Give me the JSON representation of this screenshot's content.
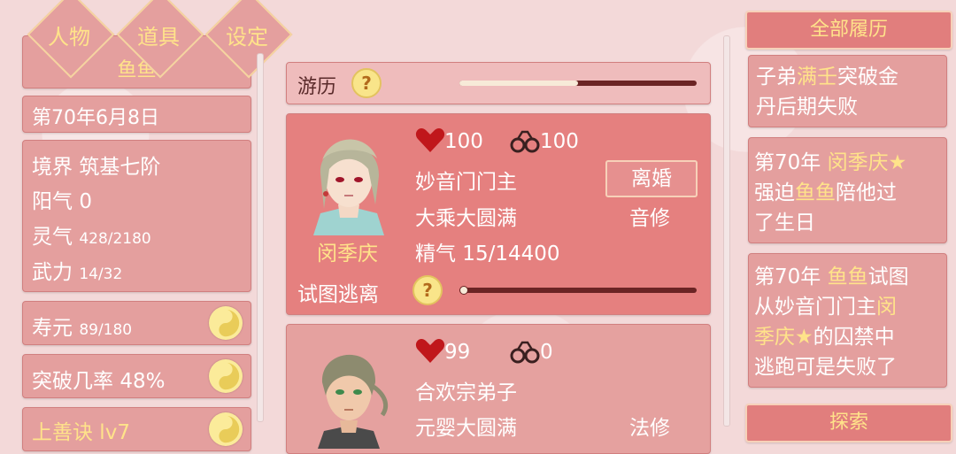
{
  "top_menu": [
    "人物",
    "道具",
    "设定"
  ],
  "left": {
    "name": "鱼鱼",
    "date": "第70年6月8日",
    "stats": [
      {
        "label": "境界",
        "value": "筑基七阶"
      },
      {
        "label": "阳气",
        "value": "0"
      },
      {
        "label": "灵气",
        "value": "428/2180"
      },
      {
        "label": "武力",
        "value": "14/32"
      }
    ],
    "lifespan": {
      "label": "寿元",
      "value": "89/180"
    },
    "breakthrough": {
      "label": "突破几率",
      "value": "48%"
    },
    "skill": "上善诀 lv7"
  },
  "middle": {
    "youli_label": "游历",
    "youli_progress": 0.5,
    "card1": {
      "name": "闵季庆",
      "heart": "100",
      "bond": "100",
      "sect": "妙音门门主",
      "realm": "大乘大圆满",
      "essence": "精气 15/14400",
      "divorce": "离婚",
      "cultivation": "音修",
      "escape_label": "试图逃离",
      "escape_progress": 0.0
    },
    "card2": {
      "heart": "99",
      "bond": "0",
      "sect": "合欢宗弟子",
      "realm": "元婴大圆满",
      "cultivation": "法修"
    }
  },
  "right": {
    "header": "全部履历",
    "log1": {
      "a": "子弟",
      "b": "满壬",
      "c": "突破金",
      "d": "丹后期失败"
    },
    "log2": {
      "l1a": "第70年 ",
      "l1b": "闵季庆★",
      "l2a": "强迫",
      "l2b": "鱼鱼",
      "l2c": "陪他过",
      "l3": "了生日"
    },
    "log3": {
      "l1a": "第70年 ",
      "l1b": "鱼鱼",
      "l1c": "试图",
      "l2a": "从妙音门门主",
      "l2b": "闵",
      "l3a": "季庆★",
      "l3b": "的囚禁中",
      "l4": "逃跑可是失败了"
    },
    "explore": "探索"
  },
  "colors": {
    "panel": "#e49f9e",
    "highlight": "#ffe38a",
    "heart": "#c0171b"
  }
}
